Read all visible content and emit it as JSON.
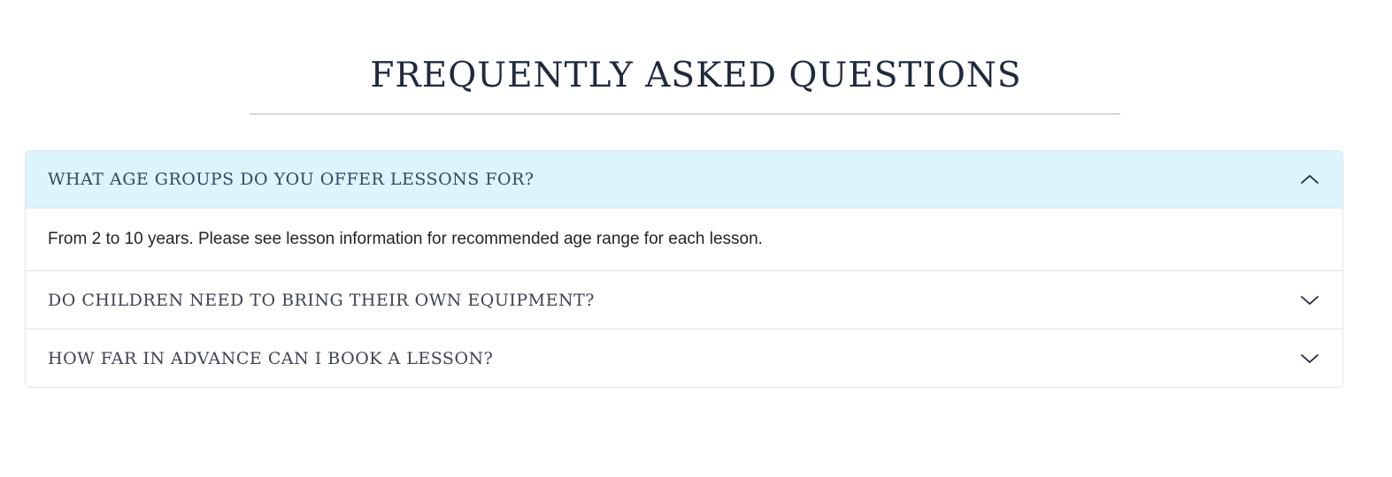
{
  "section": {
    "title": "FREQUENTLY ASKED QUESTIONS"
  },
  "faq": {
    "items": [
      {
        "question": "WHAT AGE GROUPS DO YOU OFFER LESSONS FOR?",
        "answer": "From 2 to 10 years. Please see lesson information for recommended age range for each lesson.",
        "expanded": true,
        "icon": "chevron-up-icon"
      },
      {
        "question": "DO CHILDREN NEED TO BRING THEIR OWN EQUIPMENT?",
        "expanded": false,
        "icon": "chevron-down-icon"
      },
      {
        "question": "HOW FAR IN ADVANCE CAN I BOOK A LESSON?",
        "expanded": false,
        "icon": "chevron-down-icon"
      }
    ]
  },
  "colors": {
    "active_header_bg": "#dcf4fb",
    "title_text": "#1f2a3d",
    "border": "#dee2e6"
  }
}
